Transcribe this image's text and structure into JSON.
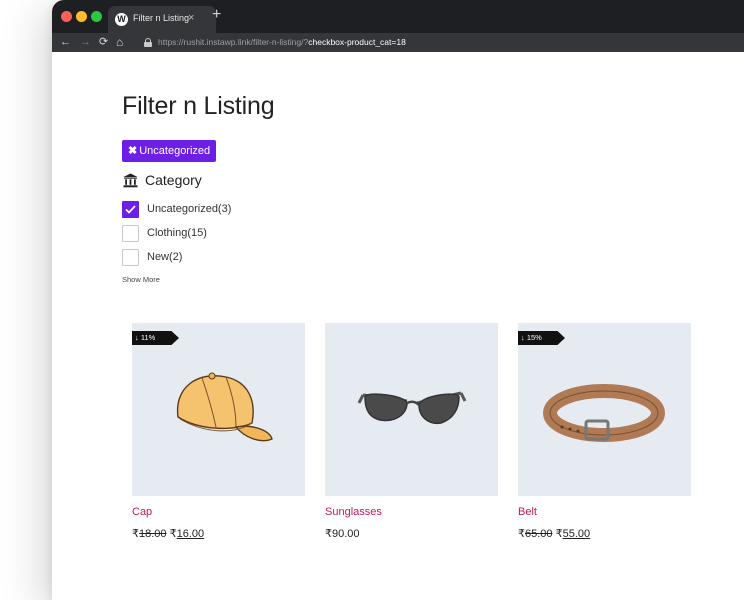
{
  "browser": {
    "tab_title": "Filter n Listing",
    "tab_close": "×",
    "new_tab": "+",
    "url_prefix": "https://rushit.instawp.link/filter-n-listing/?",
    "url_query": "checkbox-product_cat=18"
  },
  "page": {
    "title": "Filter n Listing"
  },
  "active_filter": {
    "icon": "✖",
    "label": "Uncategorized"
  },
  "filter": {
    "title": "Category",
    "options": [
      {
        "label": "Uncategorized(3)",
        "checked": true
      },
      {
        "label": "Clothing(15)",
        "checked": false
      },
      {
        "label": "New(2)",
        "checked": false
      }
    ],
    "show_more": "Show More"
  },
  "products": [
    {
      "name": "Cap",
      "badge": "↓ 11%",
      "currency": "₹",
      "old_price": "18.00",
      "price": "16.00"
    },
    {
      "name": "Sunglasses",
      "badge": "",
      "currency": "₹",
      "old_price": "",
      "price": "90.00"
    },
    {
      "name": "Belt",
      "badge": "↓ 15%",
      "currency": "₹",
      "old_price": "65.00",
      "price": "55.00"
    }
  ],
  "colors": {
    "accent": "#6d1fe8",
    "product_name": "#c2185b",
    "image_bg": "#e5ebf1"
  }
}
